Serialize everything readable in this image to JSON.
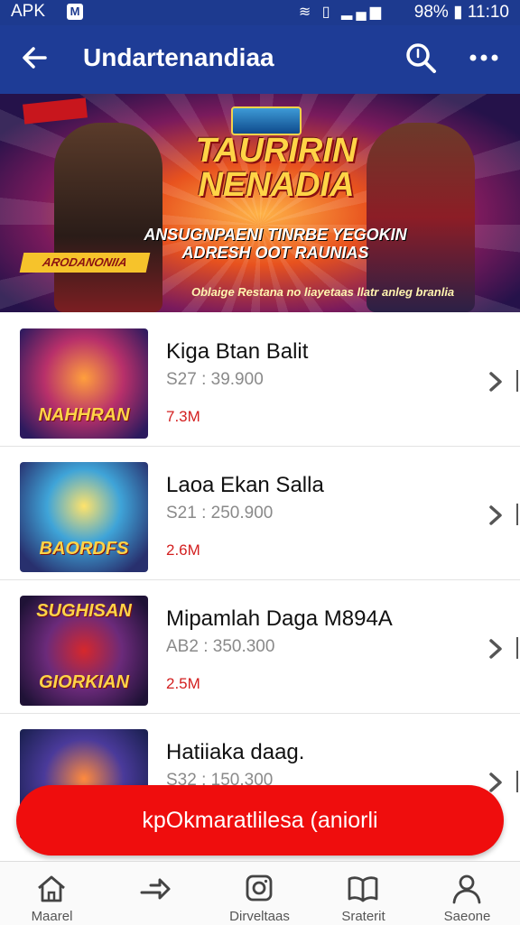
{
  "status_bar": {
    "carrier": "APK",
    "carrier_icon": "M",
    "battery": "98%",
    "time": "11:10"
  },
  "app_bar": {
    "title": "Undartenandiaa"
  },
  "banner": {
    "corner_tag": "",
    "logo_text": "",
    "title": "TAURIRIN NENADIA",
    "subtitle": "ANSUGNPAENI TINRBE YEGOKIN ADRESH OOT RAUNIAS",
    "tag": "ARODANONIIA",
    "caption": "Oblaige Restana no liayetaas llatr anleg branlia"
  },
  "items": [
    {
      "name": "Kiga Btan Balit",
      "meta": "S27 : 39.900",
      "size": "7.3M",
      "thumb_text": "NAHHRAN",
      "thumb_top": ""
    },
    {
      "name": "Laoa Ekan Salla",
      "meta": "S21 : 250.900",
      "size": "2.6M",
      "thumb_text": "BAORDFS",
      "thumb_top": ""
    },
    {
      "name": "Mipamlah Daga M894A",
      "meta": "AB2 : 350.300",
      "size": "2.5M",
      "thumb_text": "GIORKIAN",
      "thumb_top": "SUGHISAN"
    },
    {
      "name": "Hatiiaka daag.",
      "meta": "S32 : 150.300",
      "size": "",
      "thumb_text": "",
      "thumb_top": ""
    }
  ],
  "cta": {
    "label": "kpOkmaratlilesa (aniorli"
  },
  "bottom_nav": [
    {
      "label": "Maarel",
      "icon": "home-icon"
    },
    {
      "label": "",
      "icon": "share-icon"
    },
    {
      "label": "Dirveltaas",
      "icon": "instagram-icon"
    },
    {
      "label": "Sraterit",
      "icon": "book-icon"
    },
    {
      "label": "Saeone",
      "icon": "profile-icon"
    }
  ],
  "colors": {
    "primary": "#1e3c96",
    "accent": "#ef0d0d",
    "price_red": "#d32020"
  }
}
